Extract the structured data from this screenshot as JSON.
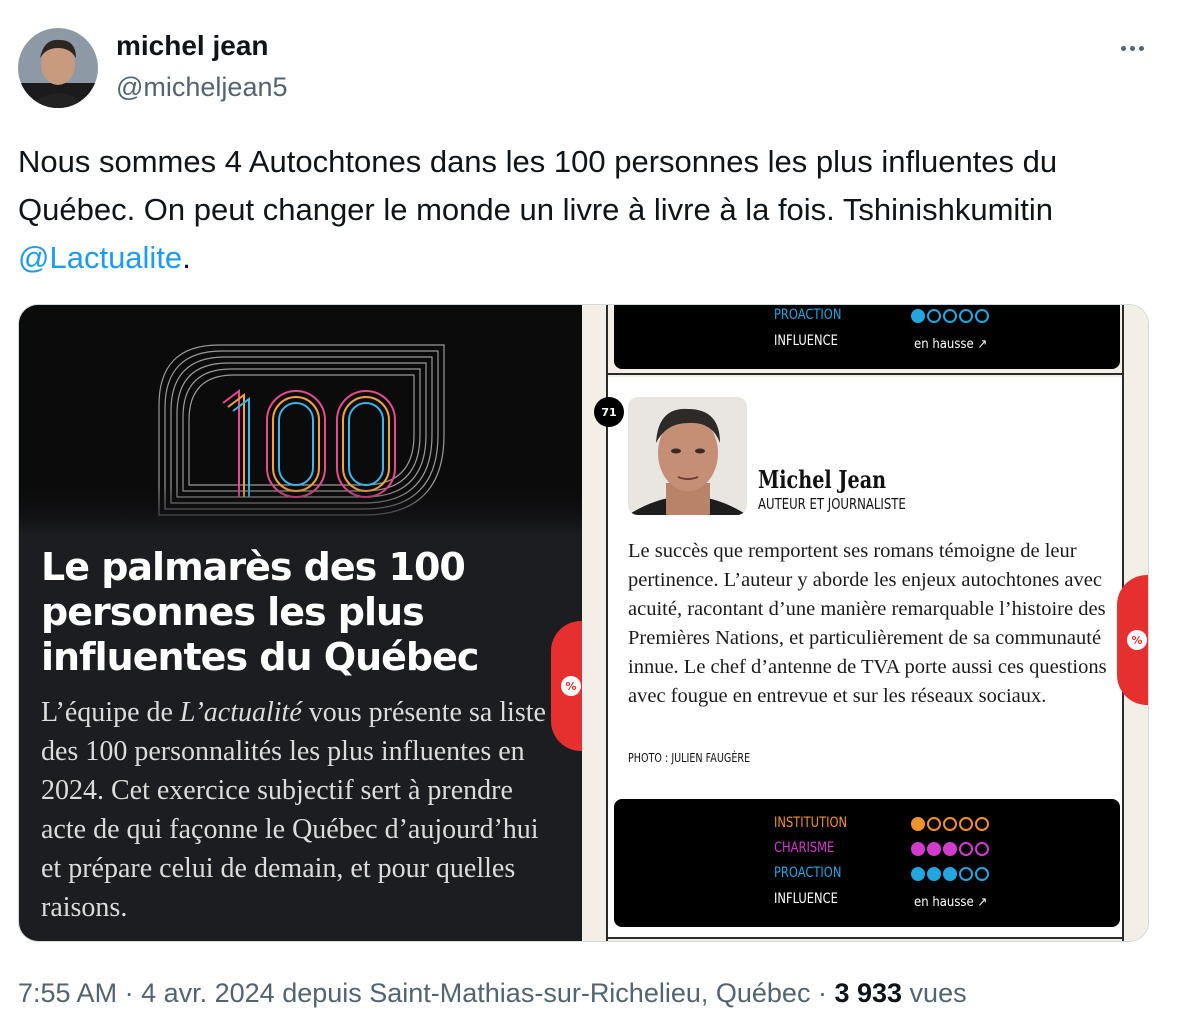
{
  "author": {
    "name": "michel jean",
    "handle": "@micheljean5"
  },
  "tweet": {
    "text_before": "Nous sommes 4 Autochtones dans les 100 personnes les plus influentes du Québec. On peut changer le monde un livre à livre à la fois. Tshinishkumitin ",
    "mention": "@Lactualite",
    "text_after": "."
  },
  "media_left": {
    "logo_text": "100",
    "title": "Le palmarès des 100 personnes les plus influentes du Québec",
    "desc_before": "L’équipe de ",
    "desc_italic": "L’actualité",
    "desc_after": " vous présente sa liste des 100 personnalités les plus influentes en 2024. Cet exercice subjectif sert à prendre acte de qui façonne le Québec d’aujourd’hui et prépare celui de demain, et pour quelles raisons.",
    "tab_icon": "%"
  },
  "media_right": {
    "top_box": {
      "rows": [
        {
          "label": "PROACTION",
          "color": "#22a6e0",
          "filled": 1
        },
        {
          "label": "INFLUENCE",
          "color": "#ffffff",
          "trend": "en hausse ↗"
        }
      ]
    },
    "rank": "71",
    "name": "Michel Jean",
    "role": "AUTEUR ET JOURNALISTE",
    "bio": "Le succès que remportent ses romans témoigne de leur pertinence. L’auteur y aborde les enjeux autochtones avec acuité, racontant d’une manière remarquable l’histoire des Premières Nations, et particulièrement de sa communauté innue. Le chef d’antenne de TVA porte aussi ces questions avec fougue en entrevue et sur les réseaux sociaux.",
    "credit": "PHOTO : JULIEN FAUGÈRE",
    "tab_icon": "%",
    "bottom_box": {
      "rows": [
        {
          "label": "INSTITUTION",
          "color": "#f0922b",
          "filled": 1
        },
        {
          "label": "CHARISME",
          "color": "#d33bd0",
          "filled": 3
        },
        {
          "label": "PROACTION",
          "color": "#22a6e0",
          "filled": 3
        },
        {
          "label": "INFLUENCE",
          "color": "#ffffff",
          "trend": "en hausse ↗"
        }
      ]
    }
  },
  "footer": {
    "time": "7:55 AM",
    "date": "4 avr. 2024",
    "location": "depuis Saint-Mathias-sur-Richelieu, Québec",
    "views_count": "3 933",
    "views_label": "vues"
  }
}
